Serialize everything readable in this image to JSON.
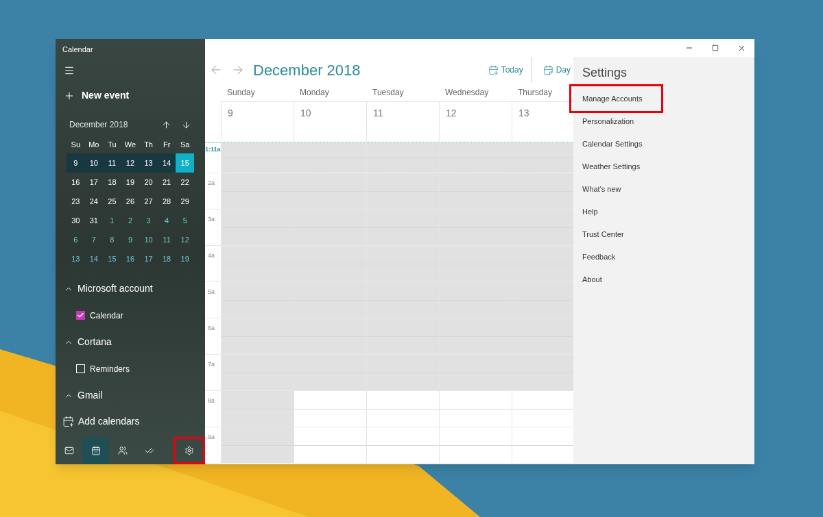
{
  "window": {
    "title": "Calendar"
  },
  "sidebar": {
    "new_event": "New event",
    "mini_calendar": {
      "title": "December 2018",
      "weekdays": [
        "Su",
        "Mo",
        "Tu",
        "We",
        "Th",
        "Fr",
        "Sa"
      ],
      "weeks": [
        {
          "selected": true,
          "days": [
            {
              "label": "9",
              "other_month": false,
              "today": false
            },
            {
              "label": "10",
              "other_month": false,
              "today": false
            },
            {
              "label": "11",
              "other_month": false,
              "today": false
            },
            {
              "label": "12",
              "other_month": false,
              "today": false
            },
            {
              "label": "13",
              "other_month": false,
              "today": false
            },
            {
              "label": "14",
              "other_month": false,
              "today": false
            },
            {
              "label": "15",
              "other_month": false,
              "today": true
            }
          ]
        },
        {
          "selected": false,
          "days": [
            {
              "label": "16",
              "other_month": false,
              "today": false
            },
            {
              "label": "17",
              "other_month": false,
              "today": false
            },
            {
              "label": "18",
              "other_month": false,
              "today": false
            },
            {
              "label": "19",
              "other_month": false,
              "today": false
            },
            {
              "label": "20",
              "other_month": false,
              "today": false
            },
            {
              "label": "21",
              "other_month": false,
              "today": false
            },
            {
              "label": "22",
              "other_month": false,
              "today": false
            }
          ]
        },
        {
          "selected": false,
          "days": [
            {
              "label": "23",
              "other_month": false,
              "today": false
            },
            {
              "label": "24",
              "other_month": false,
              "today": false
            },
            {
              "label": "25",
              "other_month": false,
              "today": false
            },
            {
              "label": "26",
              "other_month": false,
              "today": false
            },
            {
              "label": "27",
              "other_month": false,
              "today": false
            },
            {
              "label": "28",
              "other_month": false,
              "today": false
            },
            {
              "label": "29",
              "other_month": false,
              "today": false
            }
          ]
        },
        {
          "selected": false,
          "days": [
            {
              "label": "30",
              "other_month": false,
              "today": false
            },
            {
              "label": "31",
              "other_month": false,
              "today": false
            },
            {
              "label": "1",
              "other_month": true,
              "today": false
            },
            {
              "label": "2",
              "other_month": true,
              "today": false
            },
            {
              "label": "3",
              "other_month": true,
              "today": false
            },
            {
              "label": "4",
              "other_month": true,
              "today": false
            },
            {
              "label": "5",
              "other_month": true,
              "today": false
            }
          ]
        },
        {
          "selected": false,
          "days": [
            {
              "label": "6",
              "other_month": true,
              "today": false
            },
            {
              "label": "7",
              "other_month": true,
              "today": false
            },
            {
              "label": "8",
              "other_month": true,
              "today": false
            },
            {
              "label": "9",
              "other_month": true,
              "today": false
            },
            {
              "label": "10",
              "other_month": true,
              "today": false
            },
            {
              "label": "11",
              "other_month": true,
              "today": false
            },
            {
              "label": "12",
              "other_month": true,
              "today": false
            }
          ]
        },
        {
          "selected": false,
          "days": [
            {
              "label": "13",
              "other_month": true,
              "today": false
            },
            {
              "label": "14",
              "other_month": true,
              "today": false
            },
            {
              "label": "15",
              "other_month": true,
              "today": false
            },
            {
              "label": "16",
              "other_month": true,
              "today": false
            },
            {
              "label": "17",
              "other_month": true,
              "today": false
            },
            {
              "label": "18",
              "other_month": true,
              "today": false
            },
            {
              "label": "19",
              "other_month": true,
              "today": false
            }
          ]
        }
      ]
    },
    "accounts": [
      {
        "name": "Microsoft account",
        "expanded": true,
        "calendars": [
          {
            "name": "Calendar",
            "checked": true,
            "color": "#c239b3"
          }
        ]
      },
      {
        "name": "Cortana",
        "expanded": true,
        "calendars": [
          {
            "name": "Reminders",
            "checked": false,
            "color": "#ffffff"
          }
        ]
      },
      {
        "name": "Gmail",
        "expanded": true
      }
    ],
    "add_calendars": "Add calendars",
    "nav": [
      {
        "kind": "mail",
        "selected": false,
        "highlighted": false
      },
      {
        "kind": "calendar",
        "selected": true,
        "highlighted": false
      },
      {
        "kind": "people",
        "selected": false,
        "highlighted": false
      },
      {
        "kind": "todo",
        "selected": false,
        "highlighted": false
      },
      {
        "kind": "settings",
        "selected": false,
        "highlighted": true
      }
    ]
  },
  "toolbar": {
    "title": "December 2018",
    "buttons": [
      {
        "kind": "today",
        "label": "Today"
      },
      {
        "kind": "day",
        "label": "Day"
      }
    ]
  },
  "week": {
    "days": [
      {
        "name": "Sunday",
        "date": "9"
      },
      {
        "name": "Monday",
        "date": "10"
      },
      {
        "name": "Tuesday",
        "date": "11"
      },
      {
        "name": "Wednesday",
        "date": "12"
      },
      {
        "name": "Thursday",
        "date": "13"
      }
    ],
    "hours": [
      {
        "label": "1:11a",
        "current": true,
        "slots": [
          {
            "shaded": true
          },
          {
            "shaded": true
          },
          {
            "shaded": true
          },
          {
            "shaded": true
          },
          {
            "shaded": true
          }
        ]
      },
      {
        "label": "2a",
        "current": false,
        "slots": [
          {
            "shaded": true
          },
          {
            "shaded": true
          },
          {
            "shaded": true
          },
          {
            "shaded": true
          },
          {
            "shaded": true
          }
        ]
      },
      {
        "label": "3a",
        "current": false,
        "slots": [
          {
            "shaded": true
          },
          {
            "shaded": true
          },
          {
            "shaded": true
          },
          {
            "shaded": true
          },
          {
            "shaded": true
          }
        ]
      },
      {
        "label": "4a",
        "current": false,
        "slots": [
          {
            "shaded": true
          },
          {
            "shaded": true
          },
          {
            "shaded": true
          },
          {
            "shaded": true
          },
          {
            "shaded": true
          }
        ]
      },
      {
        "label": "5a",
        "current": false,
        "slots": [
          {
            "shaded": true
          },
          {
            "shaded": true
          },
          {
            "shaded": true
          },
          {
            "shaded": true
          },
          {
            "shaded": true
          }
        ]
      },
      {
        "label": "6a",
        "current": false,
        "slots": [
          {
            "shaded": true
          },
          {
            "shaded": true
          },
          {
            "shaded": true
          },
          {
            "shaded": true
          },
          {
            "shaded": true
          }
        ]
      },
      {
        "label": "7a",
        "current": false,
        "slots": [
          {
            "shaded": true
          },
          {
            "shaded": true
          },
          {
            "shaded": true
          },
          {
            "shaded": true
          },
          {
            "shaded": true
          }
        ]
      },
      {
        "label": "8a",
        "current": false,
        "slots": [
          {
            "shaded": true
          },
          {
            "shaded": false
          },
          {
            "shaded": false
          },
          {
            "shaded": false
          },
          {
            "shaded": false
          }
        ]
      },
      {
        "label": "9a",
        "current": false,
        "slots": [
          {
            "shaded": true
          },
          {
            "shaded": false
          },
          {
            "shaded": false
          },
          {
            "shaded": false
          },
          {
            "shaded": false
          }
        ]
      }
    ]
  },
  "settings": {
    "title": "Settings",
    "items": [
      {
        "label": "Manage Accounts",
        "highlighted": true
      },
      {
        "label": "Personalization",
        "highlighted": false
      },
      {
        "label": "Calendar Settings",
        "highlighted": false
      },
      {
        "label": "Weather Settings",
        "highlighted": false
      },
      {
        "label": "What's new",
        "highlighted": false
      },
      {
        "label": "Help",
        "highlighted": false
      },
      {
        "label": "Trust Center",
        "highlighted": false
      },
      {
        "label": "Feedback",
        "highlighted": false
      },
      {
        "label": "About",
        "highlighted": false
      }
    ]
  }
}
